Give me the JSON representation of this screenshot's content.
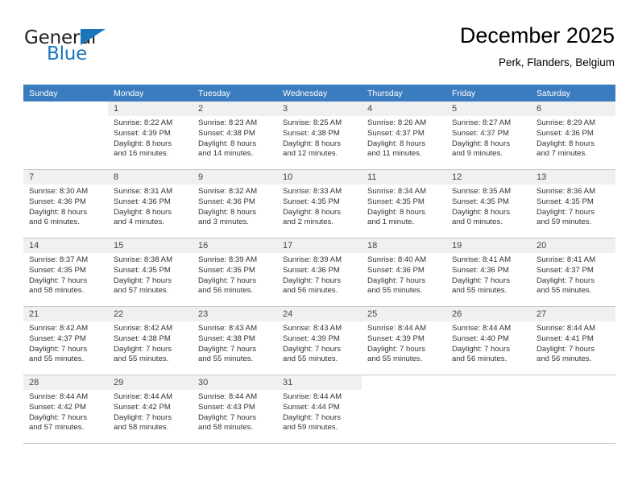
{
  "brand": {
    "name_top": "General",
    "name_bottom": "Blue",
    "accent_color": "#1b75bb"
  },
  "header": {
    "title": "December 2025",
    "subtitle": "Perk, Flanders, Belgium"
  },
  "calendar": {
    "header_color": "#3b7cbf",
    "weekday_headers": [
      "Sunday",
      "Monday",
      "Tuesday",
      "Wednesday",
      "Thursday",
      "Friday",
      "Saturday"
    ],
    "weeks": [
      [
        {
          "day": "",
          "lines": []
        },
        {
          "day": "1",
          "lines": [
            "Sunrise: 8:22 AM",
            "Sunset: 4:39 PM",
            "Daylight: 8 hours",
            "and 16 minutes."
          ]
        },
        {
          "day": "2",
          "lines": [
            "Sunrise: 8:23 AM",
            "Sunset: 4:38 PM",
            "Daylight: 8 hours",
            "and 14 minutes."
          ]
        },
        {
          "day": "3",
          "lines": [
            "Sunrise: 8:25 AM",
            "Sunset: 4:38 PM",
            "Daylight: 8 hours",
            "and 12 minutes."
          ]
        },
        {
          "day": "4",
          "lines": [
            "Sunrise: 8:26 AM",
            "Sunset: 4:37 PM",
            "Daylight: 8 hours",
            "and 11 minutes."
          ]
        },
        {
          "day": "5",
          "lines": [
            "Sunrise: 8:27 AM",
            "Sunset: 4:37 PM",
            "Daylight: 8 hours",
            "and 9 minutes."
          ]
        },
        {
          "day": "6",
          "lines": [
            "Sunrise: 8:29 AM",
            "Sunset: 4:36 PM",
            "Daylight: 8 hours",
            "and 7 minutes."
          ]
        }
      ],
      [
        {
          "day": "7",
          "lines": [
            "Sunrise: 8:30 AM",
            "Sunset: 4:36 PM",
            "Daylight: 8 hours",
            "and 6 minutes."
          ]
        },
        {
          "day": "8",
          "lines": [
            "Sunrise: 8:31 AM",
            "Sunset: 4:36 PM",
            "Daylight: 8 hours",
            "and 4 minutes."
          ]
        },
        {
          "day": "9",
          "lines": [
            "Sunrise: 8:32 AM",
            "Sunset: 4:36 PM",
            "Daylight: 8 hours",
            "and 3 minutes."
          ]
        },
        {
          "day": "10",
          "lines": [
            "Sunrise: 8:33 AM",
            "Sunset: 4:35 PM",
            "Daylight: 8 hours",
            "and 2 minutes."
          ]
        },
        {
          "day": "11",
          "lines": [
            "Sunrise: 8:34 AM",
            "Sunset: 4:35 PM",
            "Daylight: 8 hours",
            "and 1 minute."
          ]
        },
        {
          "day": "12",
          "lines": [
            "Sunrise: 8:35 AM",
            "Sunset: 4:35 PM",
            "Daylight: 8 hours",
            "and 0 minutes."
          ]
        },
        {
          "day": "13",
          "lines": [
            "Sunrise: 8:36 AM",
            "Sunset: 4:35 PM",
            "Daylight: 7 hours",
            "and 59 minutes."
          ]
        }
      ],
      [
        {
          "day": "14",
          "lines": [
            "Sunrise: 8:37 AM",
            "Sunset: 4:35 PM",
            "Daylight: 7 hours",
            "and 58 minutes."
          ]
        },
        {
          "day": "15",
          "lines": [
            "Sunrise: 8:38 AM",
            "Sunset: 4:35 PM",
            "Daylight: 7 hours",
            "and 57 minutes."
          ]
        },
        {
          "day": "16",
          "lines": [
            "Sunrise: 8:39 AM",
            "Sunset: 4:35 PM",
            "Daylight: 7 hours",
            "and 56 minutes."
          ]
        },
        {
          "day": "17",
          "lines": [
            "Sunrise: 8:39 AM",
            "Sunset: 4:36 PM",
            "Daylight: 7 hours",
            "and 56 minutes."
          ]
        },
        {
          "day": "18",
          "lines": [
            "Sunrise: 8:40 AM",
            "Sunset: 4:36 PM",
            "Daylight: 7 hours",
            "and 55 minutes."
          ]
        },
        {
          "day": "19",
          "lines": [
            "Sunrise: 8:41 AM",
            "Sunset: 4:36 PM",
            "Daylight: 7 hours",
            "and 55 minutes."
          ]
        },
        {
          "day": "20",
          "lines": [
            "Sunrise: 8:41 AM",
            "Sunset: 4:37 PM",
            "Daylight: 7 hours",
            "and 55 minutes."
          ]
        }
      ],
      [
        {
          "day": "21",
          "lines": [
            "Sunrise: 8:42 AM",
            "Sunset: 4:37 PM",
            "Daylight: 7 hours",
            "and 55 minutes."
          ]
        },
        {
          "day": "22",
          "lines": [
            "Sunrise: 8:42 AM",
            "Sunset: 4:38 PM",
            "Daylight: 7 hours",
            "and 55 minutes."
          ]
        },
        {
          "day": "23",
          "lines": [
            "Sunrise: 8:43 AM",
            "Sunset: 4:38 PM",
            "Daylight: 7 hours",
            "and 55 minutes."
          ]
        },
        {
          "day": "24",
          "lines": [
            "Sunrise: 8:43 AM",
            "Sunset: 4:39 PM",
            "Daylight: 7 hours",
            "and 55 minutes."
          ]
        },
        {
          "day": "25",
          "lines": [
            "Sunrise: 8:44 AM",
            "Sunset: 4:39 PM",
            "Daylight: 7 hours",
            "and 55 minutes."
          ]
        },
        {
          "day": "26",
          "lines": [
            "Sunrise: 8:44 AM",
            "Sunset: 4:40 PM",
            "Daylight: 7 hours",
            "and 56 minutes."
          ]
        },
        {
          "day": "27",
          "lines": [
            "Sunrise: 8:44 AM",
            "Sunset: 4:41 PM",
            "Daylight: 7 hours",
            "and 56 minutes."
          ]
        }
      ],
      [
        {
          "day": "28",
          "lines": [
            "Sunrise: 8:44 AM",
            "Sunset: 4:42 PM",
            "Daylight: 7 hours",
            "and 57 minutes."
          ]
        },
        {
          "day": "29",
          "lines": [
            "Sunrise: 8:44 AM",
            "Sunset: 4:42 PM",
            "Daylight: 7 hours",
            "and 58 minutes."
          ]
        },
        {
          "day": "30",
          "lines": [
            "Sunrise: 8:44 AM",
            "Sunset: 4:43 PM",
            "Daylight: 7 hours",
            "and 58 minutes."
          ]
        },
        {
          "day": "31",
          "lines": [
            "Sunrise: 8:44 AM",
            "Sunset: 4:44 PM",
            "Daylight: 7 hours",
            "and 59 minutes."
          ]
        },
        {
          "day": "",
          "lines": []
        },
        {
          "day": "",
          "lines": []
        },
        {
          "day": "",
          "lines": []
        }
      ]
    ]
  }
}
